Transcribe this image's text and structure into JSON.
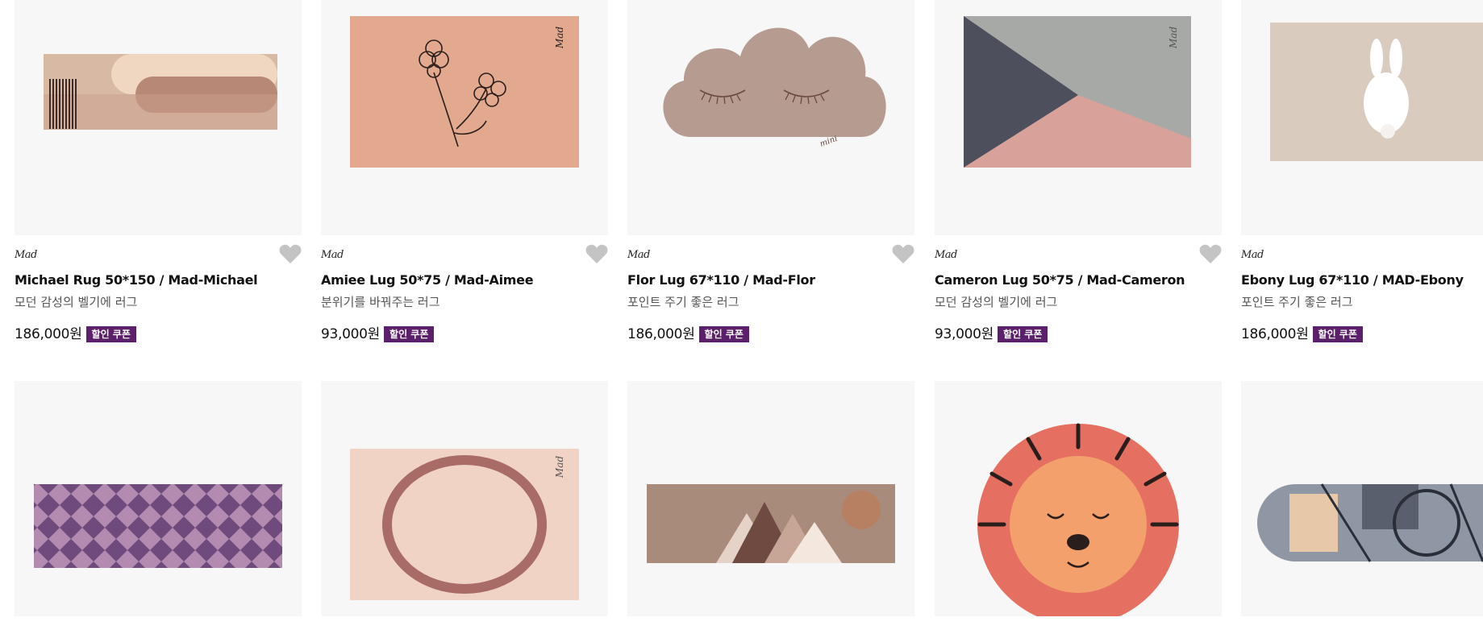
{
  "products": [
    {
      "brand": "Mad",
      "name": "Michael Rug 50*150 / Mad-Michael",
      "desc": "모던 감성의 벨기에 러그",
      "price": "186,000원",
      "badge": "할인 쿠폰"
    },
    {
      "brand": "Mad",
      "name": "Amiee Lug 50*75 / Mad-Aimee",
      "desc": "분위기를 바꿔주는 러그",
      "price": "93,000원",
      "badge": "할인 쿠폰"
    },
    {
      "brand": "Mad",
      "name": "Flor Lug 67*110 / Mad-Flor",
      "desc": "포인트 주기 좋은 러그",
      "price": "186,000원",
      "badge": "할인 쿠폰"
    },
    {
      "brand": "Mad",
      "name": "Cameron Lug 50*75 / Mad-Cameron",
      "desc": "모던 감성의 벨기에 러그",
      "price": "93,000원",
      "badge": "할인 쿠폰"
    },
    {
      "brand": "Mad",
      "name": "Ebony Lug 67*110 / MAD-Ebony",
      "desc": "포인트 주기 좋은 러그",
      "price": "186,000원",
      "badge": "할인 쿠폰"
    }
  ],
  "colors": {
    "badge": "#5b1f6b",
    "heart": "#c4c4c4",
    "thumb_bg": "#f7f7f7"
  },
  "icons": {
    "wishlist": "heart-icon"
  }
}
